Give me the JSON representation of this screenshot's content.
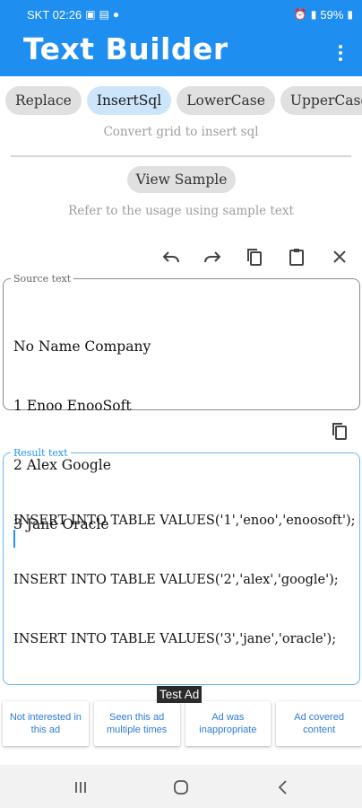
{
  "status_bar": {
    "carrier_time": "SKT 02:26",
    "battery_percent": "59%"
  },
  "app_bar": {
    "title": "Text Builder"
  },
  "mode_chips": [
    {
      "label": "Replace",
      "active": false
    },
    {
      "label": "InsertSql",
      "active": true
    },
    {
      "label": "LowerCase",
      "active": false
    },
    {
      "label": "UpperCase",
      "active": false
    }
  ],
  "mode_hint": "Convert grid to insert sql",
  "sample": {
    "button_label": "View Sample",
    "hint": "Refer to the usage using sample text"
  },
  "source": {
    "label": "Source text",
    "lines": [
      "No Name Company",
      "1 Enoo EnooSoft",
      "2 Alex Google",
      "3 Jane Oracle"
    ]
  },
  "result": {
    "label": "Result text",
    "lines": [
      "INSERT INTO TABLE VALUES('1','enoo','enoosoft');",
      "INSERT INTO TABLE VALUES('2','alex','google');",
      "INSERT INTO TABLE VALUES('3','jane','oracle');"
    ]
  },
  "ad": {
    "tag": "Test Ad",
    "options": [
      "Not interested in this ad",
      "Seen this ad multiple times",
      "Ad was inappropriate",
      "Ad covered content"
    ]
  },
  "icons": {
    "undo": "undo-icon",
    "redo": "redo-icon",
    "copy": "copy-icon",
    "paste": "paste-icon",
    "clear": "close-icon"
  },
  "colors": {
    "primary": "#1f8ef1",
    "chip_active": "#cde5fb",
    "chip": "#e0e0e0",
    "result_accent": "#2196f3"
  }
}
